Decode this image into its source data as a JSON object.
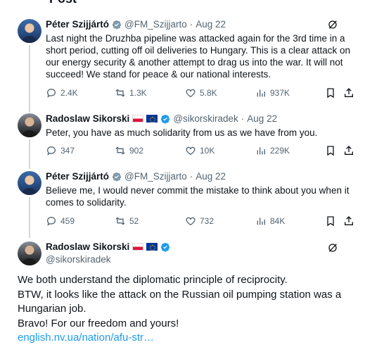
{
  "header": {
    "fragment": "Post"
  },
  "tweets": [
    {
      "name": "Péter Szijjártó",
      "handle": "@FM_Szijjarto",
      "dot": "·",
      "date": "Aug 22",
      "text": "Last night the Druzhba pipeline was attacked again for the 3rd time in a short period, cutting off oil deliveries to Hungary. This is a clear attack on our energy security & another attempt to drag us into the war. It will not succeed! We stand for peace & our national interests.",
      "replies": "2.4K",
      "reposts": "1.3K",
      "likes": "5.8K",
      "views": "937K"
    },
    {
      "name": "Radoslaw Sikorski",
      "handle": "@sikorskiradek",
      "dot": "·",
      "date": "Aug 22",
      "text": "Peter, you have as much solidarity from us as we have from you.",
      "replies": "347",
      "reposts": "902",
      "likes": "10K",
      "views": "229K"
    },
    {
      "name": "Péter Szijjártó",
      "handle": "@FM_Szijjarto",
      "dot": "·",
      "date": "Aug 22",
      "text": "Believe me, I would never commit the mistake to think about you when it comes to solidarity.",
      "replies": "459",
      "reposts": "52",
      "likes": "732",
      "views": "84K"
    }
  ],
  "main": {
    "name": "Radoslaw Sikorski",
    "handle": "@sikorskiradek",
    "lines": [
      "We both understand the diplomatic principle of reciprocity.",
      "BTW, it looks like the attack on the Russian oil pumping station was a Hungarian job.",
      "Bravo! For our freedom and yours!"
    ],
    "link": "english.nv.ua/nation/afu-str…"
  },
  "colors": {
    "accent": "#1d9bf0",
    "muted": "#536471",
    "text": "#0f1419",
    "line": "#cfd9de"
  },
  "icons": [
    "verified-badge-icon",
    "grok-icon",
    "reply-icon",
    "repost-icon",
    "like-icon",
    "views-icon",
    "bookmark-icon",
    "share-icon",
    "poland-flag-icon",
    "eu-flag-icon"
  ]
}
